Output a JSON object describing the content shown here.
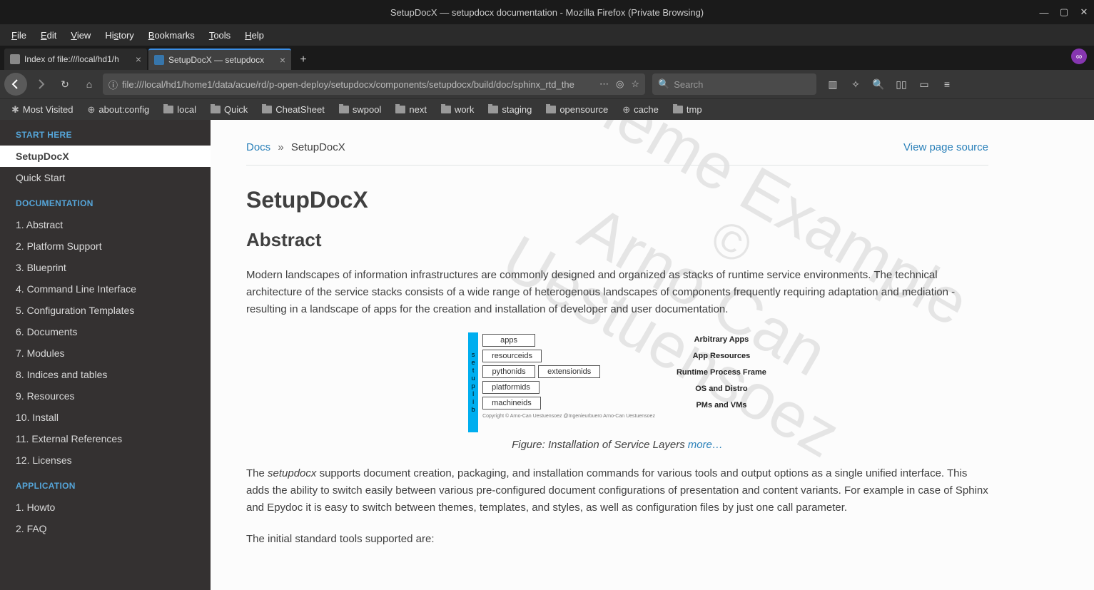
{
  "window": {
    "title": "SetupDocX — setupdocx documentation - Mozilla Firefox (Private Browsing)"
  },
  "menubar": [
    "File",
    "Edit",
    "View",
    "History",
    "Bookmarks",
    "Tools",
    "Help"
  ],
  "tabs": [
    {
      "label": "Index of file:///local/hd1/h",
      "active": false
    },
    {
      "label": "SetupDocX — setupdocx",
      "active": true
    }
  ],
  "url": "file:///local/hd1/home1/data/acue/rd/p-open-deploy/setupdocx/components/setupdocx/build/doc/sphinx_rtd_the",
  "search_placeholder": "Search",
  "bookmarks": [
    {
      "label": "Most Visited",
      "icon": "gear"
    },
    {
      "label": "about:config",
      "icon": "globe"
    },
    {
      "label": "local",
      "icon": "folder"
    },
    {
      "label": "Quick",
      "icon": "folder"
    },
    {
      "label": "CheatSheet",
      "icon": "folder"
    },
    {
      "label": "swpool",
      "icon": "folder"
    },
    {
      "label": "next",
      "icon": "folder"
    },
    {
      "label": "work",
      "icon": "folder"
    },
    {
      "label": "staging",
      "icon": "folder"
    },
    {
      "label": "opensource",
      "icon": "folder"
    },
    {
      "label": "cache",
      "icon": "globe"
    },
    {
      "label": "tmp",
      "icon": "folder"
    }
  ],
  "sidebar": {
    "sections": [
      {
        "caption": "START HERE",
        "items": [
          "SetupDocX",
          "Quick Start"
        ],
        "current": 0
      },
      {
        "caption": "DOCUMENTATION",
        "items": [
          "1. Abstract",
          "2. Platform Support",
          "3. Blueprint",
          "4. Command Line Interface",
          "5. Configuration Templates",
          "6. Documents",
          "7. Modules",
          "8. Indices and tables",
          "9. Resources",
          "10. Install",
          "11. External References",
          "12. Licenses"
        ]
      },
      {
        "caption": "APPLICATION",
        "items": [
          "1. Howto",
          "2. FAQ"
        ]
      }
    ]
  },
  "breadcrumb": {
    "root": "Docs",
    "sep": "»",
    "current": "SetupDocX",
    "viewsource": "View page source"
  },
  "page": {
    "h1": "SetupDocX",
    "h2": "Abstract",
    "p1": "Modern landscapes of information infrastructures are commonly designed and organized as stacks of runtime service environments. The technical architecture of the service stacks consists of a wide range of heterogenous landscapes of components frequently requiring adaptation and mediation - resulting in a landscape of apps for the creation and installation of developer and user documentation.",
    "figcaption": "Figure: Installation of Service Layers",
    "figmore": "more…",
    "p2a": "The ",
    "p2em": "setupdocx",
    "p2b": " supports document creation, packaging, and installation commands for various tools and output options as a single unified interface. This adds the ability to switch easily between various pre-configured document configurations of presentation and content variants. For example in case of Sphinx and Epydoc it is easy to switch between themes, templates, and styles, as well as configuration files by just one call parameter.",
    "p3": "The initial standard tools supported are:"
  },
  "diagram": {
    "side": "setuplib",
    "rows": [
      {
        "boxes": [
          "apps"
        ],
        "label": "Arbitrary Apps"
      },
      {
        "boxes": [
          "resourceids"
        ],
        "label": "App Resources"
      },
      {
        "boxes": [
          "pythonids",
          "extensionids"
        ],
        "label": "Runtime Process Frame"
      },
      {
        "boxes": [
          "platformids"
        ],
        "label": "OS and Distro"
      },
      {
        "boxes": [
          "machineids"
        ],
        "label": "PMs and VMs"
      }
    ]
  },
  "watermark": {
    "l1": "Theme Example",
    "l2": "©",
    "l3": "Arno Can",
    "l4": "Uestuensoez"
  }
}
